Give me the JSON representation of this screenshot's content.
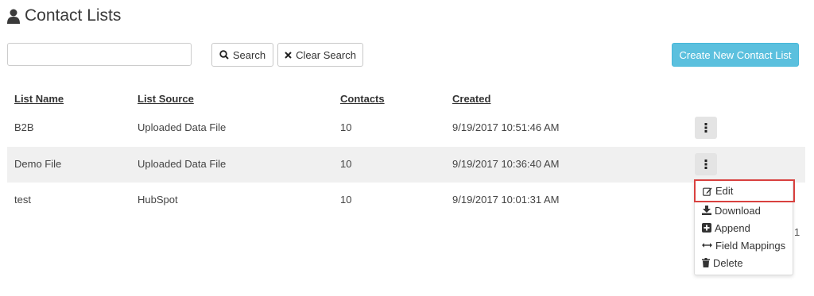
{
  "header": {
    "title": "Contact Lists",
    "icon": "user-icon"
  },
  "search": {
    "placeholder": "",
    "value": "",
    "search_label": "Search",
    "clear_label": "Clear Search"
  },
  "toolbar": {
    "create_label": "Create New Contact List"
  },
  "table": {
    "columns": [
      "List Name",
      "List Source",
      "Contacts",
      "Created"
    ],
    "rows": [
      {
        "name": "B2B",
        "source": "Uploaded Data File",
        "contacts": "10",
        "created": "9/19/2017 10:51:46 AM"
      },
      {
        "name": "Demo File",
        "source": "Uploaded Data File",
        "contacts": "10",
        "created": "9/19/2017 10:36:40 AM"
      },
      {
        "name": "test",
        "source": "HubSpot",
        "contacts": "10",
        "created": "9/19/2017 10:01:31 AM"
      }
    ]
  },
  "menu": {
    "items": [
      {
        "label": "Edit",
        "icon": "edit-icon"
      },
      {
        "label": "Download",
        "icon": "download-icon"
      },
      {
        "label": "Append",
        "icon": "plus-square-icon"
      },
      {
        "label": "Field Mappings",
        "icon": "arrows-horizontal-icon"
      },
      {
        "label": "Delete",
        "icon": "trash-icon"
      }
    ]
  },
  "pagination": {
    "current_page": "1"
  },
  "colors": {
    "accent": "#5bc0de",
    "highlight_border": "#d9413f",
    "stripe": "#f0f0f0"
  }
}
